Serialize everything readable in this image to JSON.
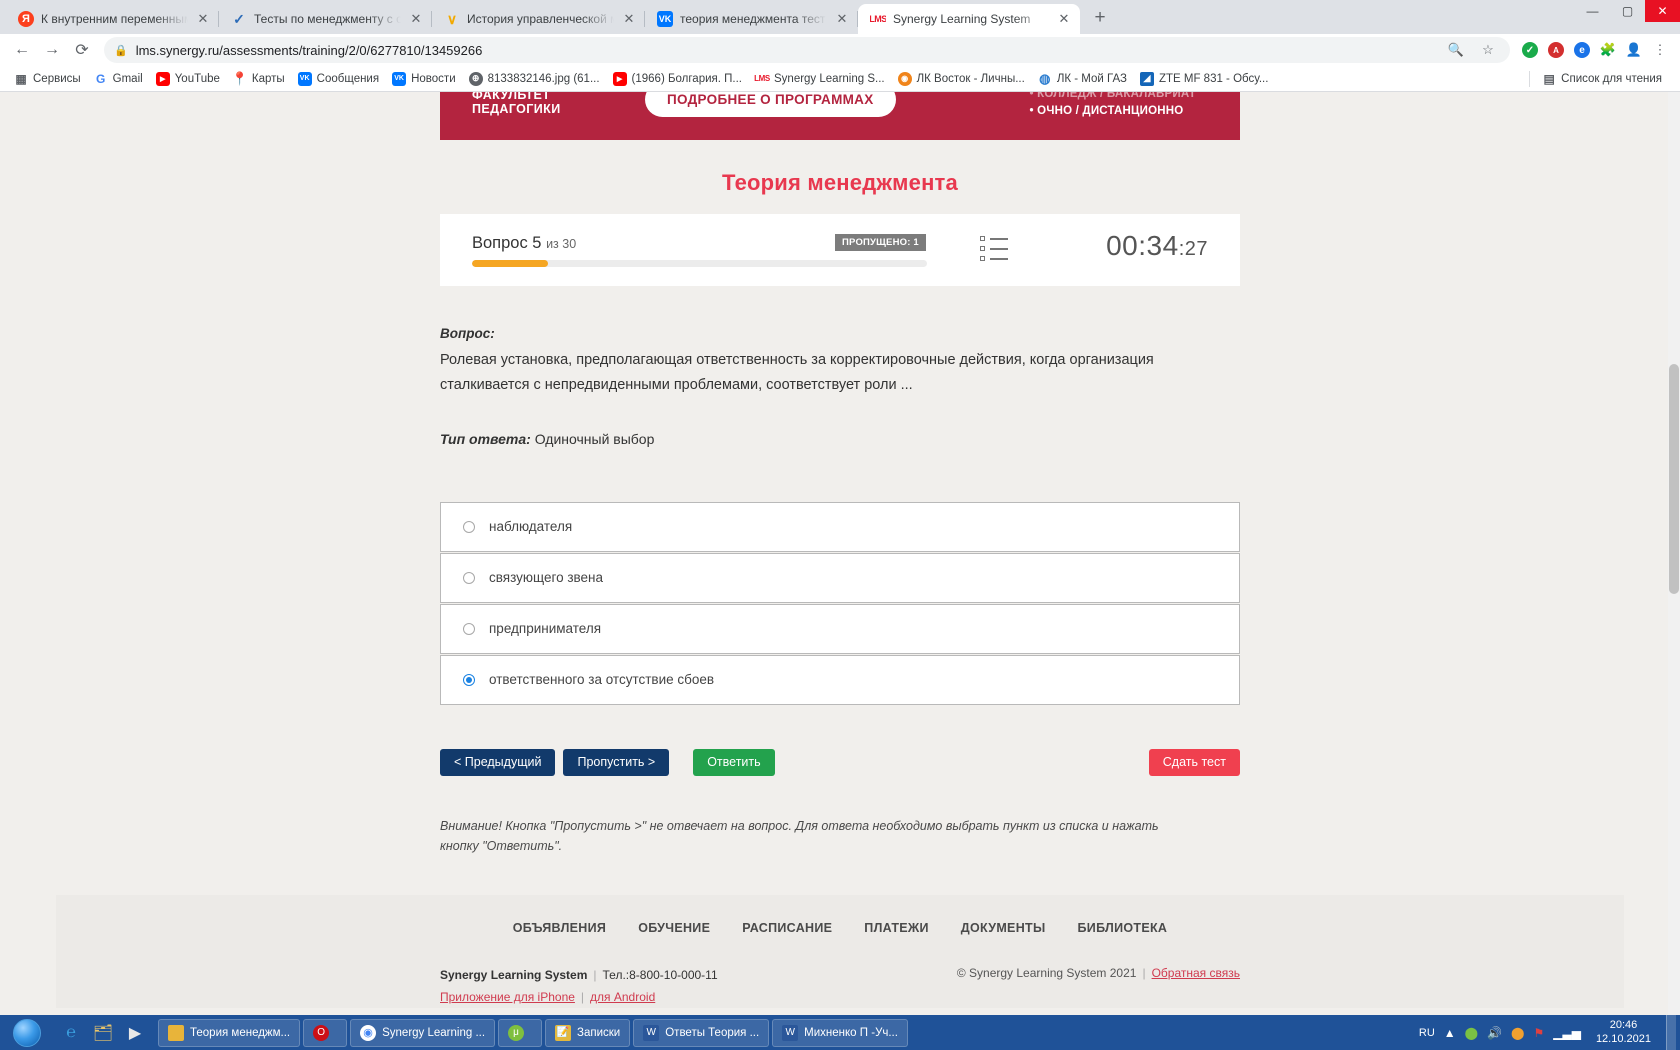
{
  "window": {
    "minimize": "—",
    "maximize": "▢",
    "close": "✕"
  },
  "tabs": [
    {
      "favicon": "yandex-icon",
      "title": "К внутренним переменным орг",
      "close": "✕",
      "active": false
    },
    {
      "favicon": "checkmark-icon",
      "title": "Тесты по менеджменту с ответа",
      "close": "✕",
      "active": false
    },
    {
      "favicon": "vcheck-icon",
      "title": "История управленческой мысл",
      "close": "✕",
      "active": false
    },
    {
      "favicon": "vk-icon",
      "title": "теория менеджмента тест для с",
      "close": "✕",
      "active": false
    },
    {
      "favicon": "lms-icon",
      "title": "Synergy Learning System",
      "close": "✕",
      "active": true
    }
  ],
  "newtab_label": "+",
  "toolbar": {
    "back": "←",
    "forward": "→",
    "reload": "⟳",
    "lock": "🔒",
    "url": "lms.synergy.ru/assessments/training/2/0/6277810/13459266",
    "search_icon": "🔍",
    "bookmark_star": "☆",
    "ext_green": "✓",
    "ext_pdf": "A",
    "ext_blue": "e",
    "ext_puzzle": "🧩",
    "profile": "👤",
    "menu": "⋮"
  },
  "bookmarks": {
    "items": [
      {
        "icon": "apps-grid-icon",
        "label": "Сервисы"
      },
      {
        "icon": "gmail-icon",
        "label": "Gmail"
      },
      {
        "icon": "youtube-icon",
        "label": "YouTube"
      },
      {
        "icon": "maps-pin-icon",
        "label": "Карты"
      },
      {
        "icon": "vk-icon",
        "label": "Сообщения"
      },
      {
        "icon": "vk-icon",
        "label": "Новости"
      },
      {
        "icon": "globe-icon",
        "label": "8133832146.jpg (61..."
      },
      {
        "icon": "youtube-icon",
        "label": "(1966) Болгария. П..."
      },
      {
        "icon": "lms-icon",
        "label": "Synergy Learning S..."
      },
      {
        "icon": "vostok-icon",
        "label": "ЛК Восток - Личны..."
      },
      {
        "icon": "gaz-icon",
        "label": "ЛК - Мой ГАЗ"
      },
      {
        "icon": "zte-icon",
        "label": "ZTE MF 831 - Обсу..."
      }
    ],
    "reading_list": {
      "icon": "reading-list-icon",
      "label": "Список для чтения"
    }
  },
  "banner": {
    "left_line1": "ФАКУЛЬТЕТ",
    "left_line2": "ПЕДАГОГИКИ",
    "button": "ПОДРОБНЕЕ О ПРОГРАММАХ",
    "right_line1": "• КОЛЛЕДЖ / БАКАЛАВРИАТ",
    "right_line2": "• ОЧНО / ДИСТАНЦИОННО"
  },
  "quiz": {
    "title": "Теория менеджмента",
    "question_number_label": "Вопрос 5",
    "question_of": "из 30",
    "progress_percent": 16.6,
    "skipped_badge": "ПРОПУЩЕНО: 1",
    "list_icon": "list-icon",
    "timer": "00:34",
    "timer_seconds": ":27",
    "question_label": "Вопрос:",
    "question_text": "Ролевая установка, предполагающая ответственность за корректировочные действия, когда организация сталкивается с непредвиденными проблемами, соответствует роли ...",
    "answer_type_label": "Тип ответа:",
    "answer_type_value": "Одиночный выбор",
    "options": [
      {
        "label": "наблюдателя",
        "checked": false
      },
      {
        "label": "связующего звена",
        "checked": false
      },
      {
        "label": "предпринимателя",
        "checked": false
      },
      {
        "label": "ответственного за отсутствие сбоев",
        "checked": true
      }
    ],
    "buttons": {
      "previous": "< Предыдущий",
      "skip": "Пропустить >",
      "answer": "Ответить",
      "submit": "Сдать тест"
    },
    "note": "Внимание! Кнопка \"Пропустить >\" не отвечает на вопрос. Для ответа необходимо выбрать пункт из списка и нажать кнопку \"Ответить\"."
  },
  "footer": {
    "nav": [
      "ОБЪЯВЛЕНИЯ",
      "ОБУЧЕНИЕ",
      "РАСПИСАНИЕ",
      "ПЛАТЕЖИ",
      "ДОКУМЕНТЫ",
      "БИБЛИОТЕКА"
    ],
    "brand": "Synergy Learning System",
    "phone": "Тел.:8-800-10-000-11",
    "link_iphone": "Приложение для iPhone",
    "link_android": "для Android",
    "copyright": "© Synergy Learning System 2021",
    "feedback": "Обратная связь"
  },
  "taskbar": {
    "start": "start-orb",
    "quick": [
      "ie-icon",
      "explorer-icon",
      "media-icon"
    ],
    "items": [
      {
        "icon": "folder-icon",
        "label": "Теория менеджм..."
      },
      {
        "icon": "opera-icon",
        "label": ""
      },
      {
        "icon": "chrome-icon",
        "label": "Synergy Learning ..."
      },
      {
        "icon": "utorrent-icon",
        "label": ""
      },
      {
        "icon": "notes-icon",
        "label": "Записки"
      },
      {
        "icon": "word-icon",
        "label": "Ответы Теория ..."
      },
      {
        "icon": "word-icon",
        "label": "Михненко П -Уч..."
      }
    ],
    "lang": "RU",
    "tray": [
      "chevron-up-icon",
      "shield-icon",
      "volume-icon",
      "network-icon",
      "flag-icon",
      "signal-icon"
    ],
    "time": "20:46",
    "date": "12.10.2021"
  },
  "colors": {
    "brand_red": "#e8384f",
    "banner_red": "#b3243f",
    "progress_orange": "#f5a623",
    "navy": "#123a6b",
    "green": "#23a24d",
    "submit_red": "#f0404f"
  }
}
